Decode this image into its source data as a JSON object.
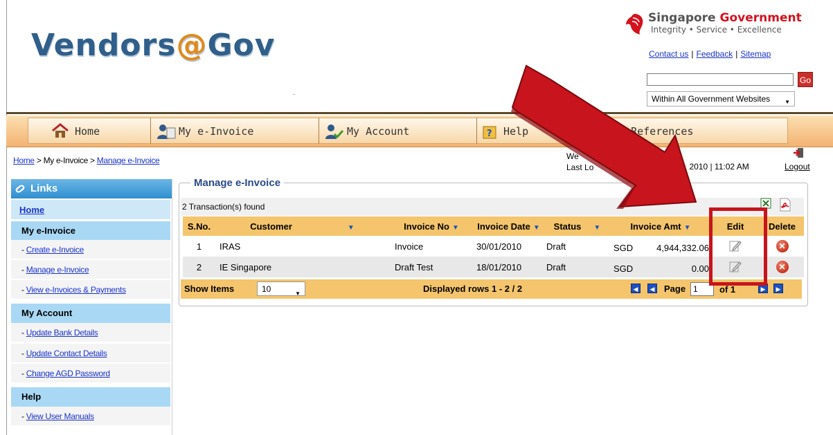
{
  "header": {
    "logo_main": "Vendors",
    "logo_at": "@",
    "logo_end": "Gov",
    "gov_title_1": "Singapore",
    "gov_title_2": "Government",
    "gov_tagline": "Integrity • Service • Excellence",
    "links": [
      "Contact us",
      "Feedback",
      "Sitemap"
    ],
    "search_value": "",
    "go_label": "Go",
    "scope_selected": "Within All Government Websites"
  },
  "nav": {
    "items": [
      "Home",
      "My e-Invoice",
      "My Account",
      "Help",
      "ıl References"
    ]
  },
  "breadcrumb": {
    "home": "Home",
    "sep": " > ",
    "current": "My e-Invoice",
    "manage": "Manage e-Invoice"
  },
  "session": {
    "welcome_partial": "We",
    "last_login_partial": "Last Lo",
    "date_partial": "ay, 2010 | 11:02 AM",
    "logout": "Logout"
  },
  "sidebar": {
    "title": "Links",
    "home": "Home",
    "sections": [
      {
        "title": "My e-Invoice",
        "items": [
          "Create e-Invoice",
          "Manage e-Invoice",
          "View e-Invoices & Payments"
        ]
      },
      {
        "title": "My Account",
        "items": [
          "Update Bank Details",
          "Update Contact Details",
          "Change AGD Password"
        ]
      },
      {
        "title": "Help",
        "items": [
          "View User Manuals"
        ]
      }
    ]
  },
  "main": {
    "title": "Manage e-Invoice",
    "found": "2 Transaction(s) found",
    "columns": [
      "S.No.",
      "Customer",
      "Invoice No",
      "Invoice Date",
      "Status",
      "Invoice Amt",
      "Edit",
      "Delete"
    ],
    "rows": [
      {
        "sno": "1",
        "customer": "IRAS",
        "invoice_no": "Invoice",
        "date": "30/01/2010",
        "status": "Draft",
        "currency": "SGD",
        "amount": "4,944,332.06"
      },
      {
        "sno": "2",
        "customer": "IE Singapore",
        "invoice_no": "Draft Test",
        "date": "18/01/2010",
        "status": "Draft",
        "currency": "SGD",
        "amount": "0.00"
      }
    ],
    "show_items_label": "Show Items",
    "show_items_value": "10",
    "displayed_rows": "Displayed rows 1 - 2 / 2",
    "page_label": "Page",
    "page_value": "1",
    "of_label": "of 1"
  },
  "colors": {
    "nav_bg": "#f3b372",
    "header_row": "#f4c56c",
    "sidebar_section": "#a9d8f4",
    "highlight": "#c8141c"
  }
}
